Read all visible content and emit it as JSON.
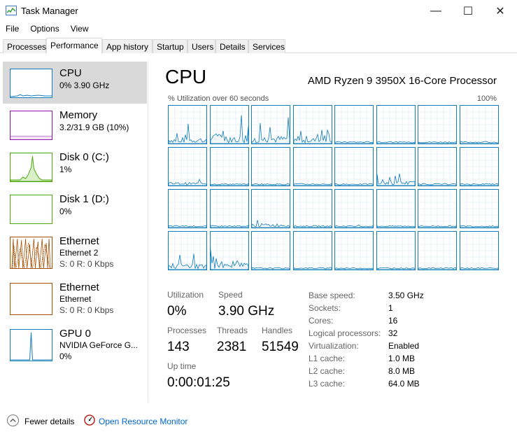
{
  "window": {
    "title": "Task Manager",
    "minimize_glyph": "—",
    "maximize_glyph": "☐",
    "close_glyph": "✕"
  },
  "menu": [
    "File",
    "Options",
    "View"
  ],
  "tabs": [
    {
      "label": "Processes",
      "active": false
    },
    {
      "label": "Performance",
      "active": true
    },
    {
      "label": "App history",
      "active": false
    },
    {
      "label": "Startup",
      "active": false
    },
    {
      "label": "Users",
      "active": false
    },
    {
      "label": "Details",
      "active": false
    },
    {
      "label": "Services",
      "active": false
    }
  ],
  "sidebar": [
    {
      "name": "CPU",
      "line1": "0% 3.90 GHz",
      "line2": "",
      "color": "#117dbb",
      "selected": true
    },
    {
      "name": "Memory",
      "line1": "3.2/31.9 GB (10%)",
      "line2": "",
      "color": "#8b12ae",
      "selected": false
    },
    {
      "name": "Disk 0 (C:)",
      "line1": "1%",
      "line2": "",
      "color": "#4da60c",
      "selected": false
    },
    {
      "name": "Disk 1 (D:)",
      "line1": "0%",
      "line2": "",
      "color": "#4da60c",
      "selected": false
    },
    {
      "name": "Ethernet",
      "line1": "Ethernet 2",
      "line2": "S: 0 R: 0 Kbps",
      "color": "#a74f01",
      "selected": false
    },
    {
      "name": "Ethernet",
      "line1": "Ethernet",
      "line2": "S: 0 R: 0 Kbps",
      "color": "#a74f01",
      "selected": false
    },
    {
      "name": "GPU 0",
      "line1": "NVIDIA GeForce G...",
      "line2": "0%",
      "color": "#117dbb",
      "selected": false
    }
  ],
  "main": {
    "title": "CPU",
    "model": "AMD Ryzen 9 3950X 16-Core Processor",
    "graph_caption": "% Utilization over 60 seconds",
    "graph_max": "100%",
    "graph_color": "#117dbb",
    "core_grid_columns": 8,
    "core_grid_rows": 4
  },
  "stats": {
    "utilization_label": "Utilization",
    "utilization_value": "0%",
    "speed_label": "Speed",
    "speed_value": "3.90 GHz",
    "processes_label": "Processes",
    "processes_value": "143",
    "threads_label": "Threads",
    "threads_value": "2381",
    "handles_label": "Handles",
    "handles_value": "51549",
    "uptime_label": "Up time",
    "uptime_value": "0:00:01:25"
  },
  "specs": [
    {
      "label": "Base speed:",
      "value": "3.50 GHz"
    },
    {
      "label": "Sockets:",
      "value": "1"
    },
    {
      "label": "Cores:",
      "value": "16"
    },
    {
      "label": "Logical processors:",
      "value": "32"
    },
    {
      "label": "Virtualization:",
      "value": "Enabled"
    },
    {
      "label": "L1 cache:",
      "value": "1.0 MB"
    },
    {
      "label": "L2 cache:",
      "value": "8.0 MB"
    },
    {
      "label": "L3 cache:",
      "value": "64.0 MB"
    }
  ],
  "footer": {
    "fewer_details": "Fewer details",
    "open_monitor": "Open Resource Monitor"
  }
}
